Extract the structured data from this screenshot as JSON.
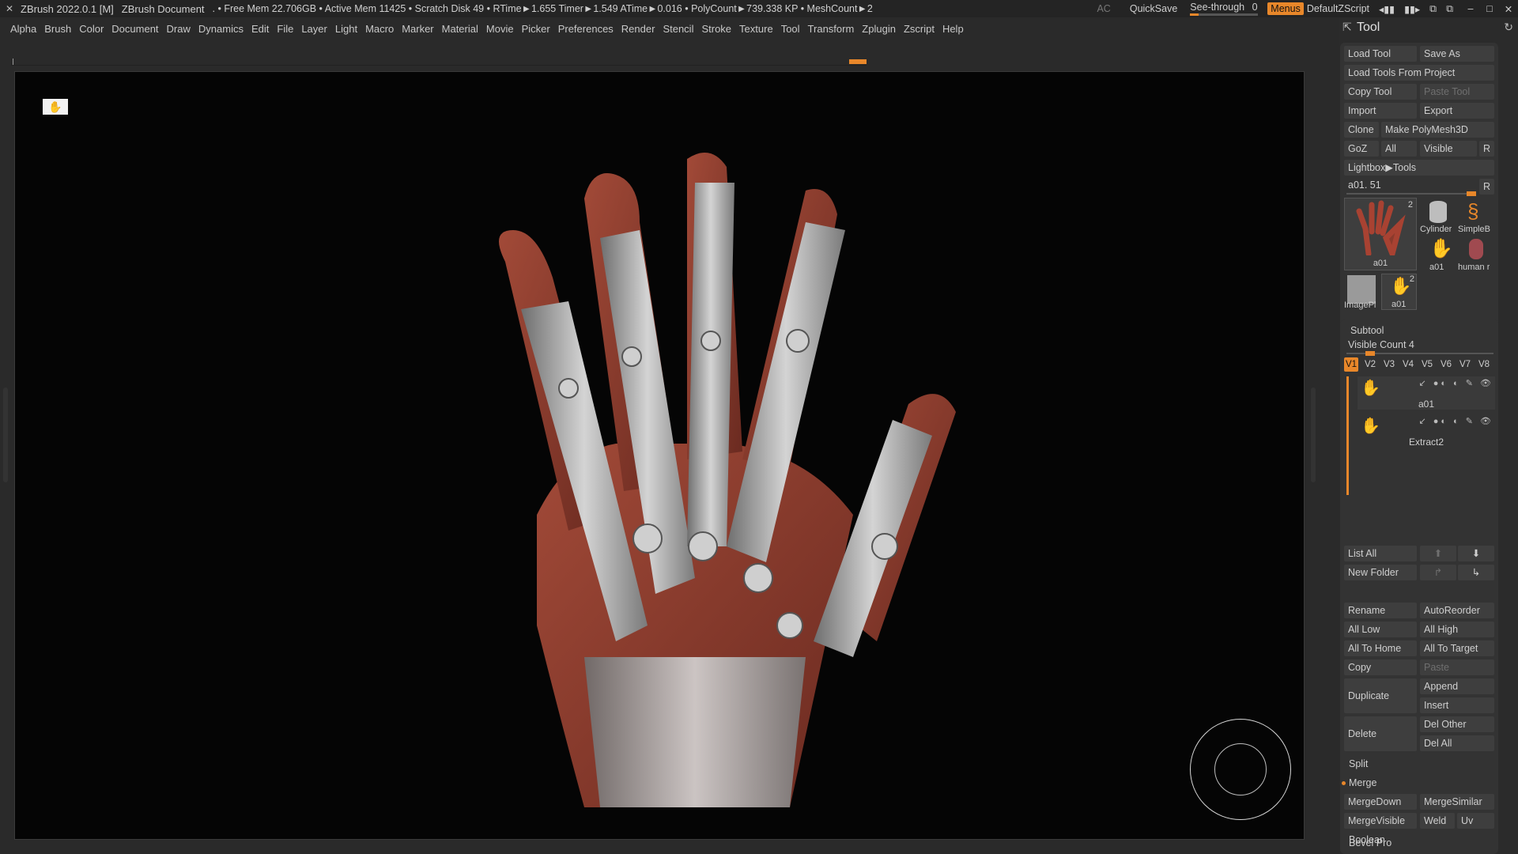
{
  "titlebar": {
    "app": "ZBrush 2022.0.1 [M]",
    "document": "ZBrush Document",
    "status": ". • Free Mem 22.706GB • Active Mem 11425 • Scratch Disk 49 •  RTime►1.655 Timer►1.549 ATime►0.016 • PolyCount►739.338 KP  • MeshCount►2",
    "ac": "AC",
    "quicksave": "QuickSave",
    "see_through_label": "See-through",
    "see_through_value": "0",
    "see_through_fraction": 0.12,
    "menus": "Menus",
    "default_zscript": "DefaultZScript"
  },
  "menubar": [
    "Alpha",
    "Brush",
    "Color",
    "Document",
    "Draw",
    "Dynamics",
    "Edit",
    "File",
    "Layer",
    "Light",
    "Macro",
    "Marker",
    "Material",
    "Movie",
    "Picker",
    "Preferences",
    "Render",
    "Stencil",
    "Stroke",
    "Texture",
    "Tool",
    "Transform",
    "Zplugin",
    "Zscript",
    "Help"
  ],
  "tool_panel": {
    "title": "Tool",
    "load_tool": "Load Tool",
    "save_as": "Save As",
    "load_tools_from_project": "Load Tools From Project",
    "copy_tool": "Copy Tool",
    "paste_tool": "Paste Tool",
    "import": "Import",
    "export": "Export",
    "clone": "Clone",
    "make_polymesh3d": "Make PolyMesh3D",
    "goz": "GoZ",
    "all": "All",
    "visible": "Visible",
    "r": "R",
    "lightbox_tools": "Lightbox▶Tools",
    "current_tool": "a01. 51",
    "thumbs": {
      "main_label": "a01",
      "main_count": "2",
      "cylinder": "Cylinder",
      "simpleb": "SimpleB",
      "a01_small": "a01",
      "human": "human r",
      "imagepl": "ImagePl",
      "a01_b": "a01",
      "a01_b_count": "2"
    }
  },
  "subtool": {
    "title": "Subtool",
    "visible_count": "Visible Count 4",
    "tabs": [
      "V1",
      "V2",
      "V3",
      "V4",
      "V5",
      "V6",
      "V7",
      "V8"
    ],
    "items": [
      {
        "name": "a01"
      },
      {
        "name": "Extract2"
      }
    ],
    "list_all": "List All",
    "new_folder": "New Folder",
    "rename": "Rename",
    "auto_reorder": "AutoReorder",
    "all_low": "All Low",
    "all_high": "All High",
    "all_to_home": "All To Home",
    "all_to_target": "All To Target",
    "copy": "Copy",
    "paste": "Paste",
    "duplicate": "Duplicate",
    "append": "Append",
    "insert": "Insert",
    "delete": "Delete",
    "del_other": "Del Other",
    "del_all": "Del All",
    "split": "Split",
    "merge": "Merge",
    "merge_down": "MergeDown",
    "merge_similar": "MergeSimilar",
    "merge_visible": "MergeVisible",
    "weld": "Weld",
    "uv": "Uv",
    "boolean": "Boolean",
    "bevel_pro": "Bevel Pro"
  },
  "colors": {
    "accent": "#e8872a",
    "skin": "#8b3a2c",
    "metal": "#a8a8a8",
    "background": "#050505"
  }
}
